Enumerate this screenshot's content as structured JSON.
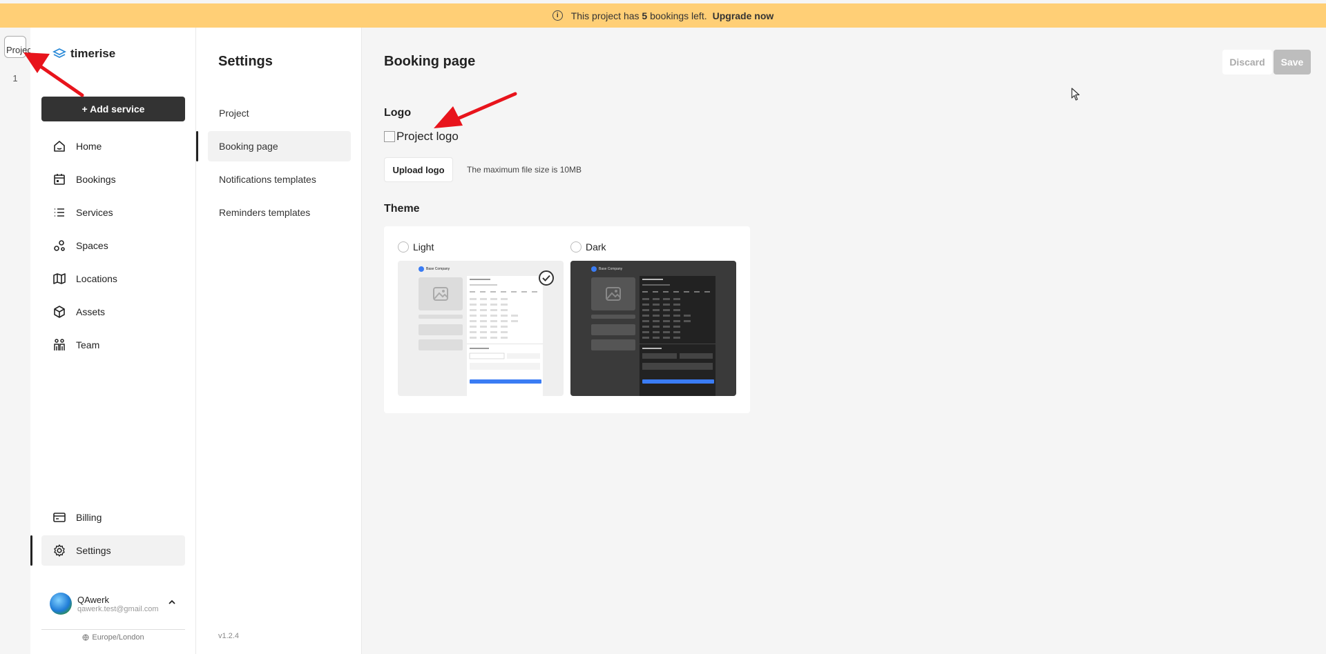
{
  "banner": {
    "prefix": "This project has",
    "count": "5",
    "suffix": "bookings left.",
    "upgrade": "Upgrade now"
  },
  "project_switcher": {
    "thumb_alt": "Project",
    "number": "1"
  },
  "brand": {
    "name": "timerise"
  },
  "sidebar": {
    "add_service": "+ Add service",
    "items": [
      {
        "label": "Home",
        "icon": "home-icon"
      },
      {
        "label": "Bookings",
        "icon": "calendar-icon"
      },
      {
        "label": "Services",
        "icon": "list-icon"
      },
      {
        "label": "Spaces",
        "icon": "spaces-icon"
      },
      {
        "label": "Locations",
        "icon": "map-icon"
      },
      {
        "label": "Assets",
        "icon": "cube-icon"
      },
      {
        "label": "Team",
        "icon": "team-icon"
      }
    ],
    "bottom_items": [
      {
        "label": "Billing",
        "icon": "credit-card-icon"
      },
      {
        "label": "Settings",
        "icon": "gear-icon",
        "active": true
      }
    ],
    "user": {
      "name": "QAwerk",
      "email": "qawerk.test@gmail.com"
    },
    "timezone": "Europe/London"
  },
  "settings": {
    "title": "Settings",
    "items": [
      {
        "label": "Project"
      },
      {
        "label": "Booking page",
        "active": true
      },
      {
        "label": "Notifications templates"
      },
      {
        "label": "Reminders templates"
      }
    ],
    "version": "v1.2.4"
  },
  "main": {
    "title": "Booking page",
    "discard": "Discard",
    "save": "Save",
    "logo_label": "Logo",
    "logo_alt": "Project logo",
    "upload": "Upload logo",
    "upload_hint": "The maximum file size is 10MB",
    "theme_label": "Theme",
    "themes": [
      {
        "label": "Light",
        "company": "Base Company"
      },
      {
        "label": "Dark",
        "company": "Base Company"
      }
    ]
  },
  "colors": {
    "banner": "#ffcf76",
    "primary_button": "#333333",
    "accent": "#3a7cf4",
    "annotation_arrow": "#e8141c"
  }
}
